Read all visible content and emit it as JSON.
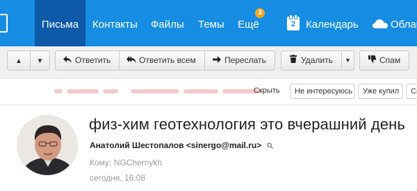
{
  "nav": {
    "items": [
      {
        "label": "Письма"
      },
      {
        "label": "Контакты"
      },
      {
        "label": "Файлы"
      },
      {
        "label": "Темы"
      },
      {
        "label": "Ещё"
      },
      {
        "label": "Календарь"
      },
      {
        "label": "Облако"
      }
    ],
    "more_badge": "3",
    "calendar_day": "2",
    "active": "Письма",
    "colors": {
      "bar": "#168de2",
      "active": "#0f5aa8",
      "badge": "#f5a623"
    }
  },
  "toolbar": {
    "up_icon": "arrow-up-icon",
    "down_icon": "arrow-down-icon",
    "reply": {
      "label": "Ответить",
      "icon": "reply-icon"
    },
    "reply_all": {
      "label": "Ответить всем",
      "icon": "reply-all-icon"
    },
    "forward": {
      "label": "Переслать",
      "icon": "forward-icon"
    },
    "delete": {
      "label": "Удалить",
      "icon": "trash-icon"
    },
    "spam": {
      "label": "Спам",
      "icon": "thumbs-down-icon"
    }
  },
  "filters": {
    "hide": "Скрыть",
    "chips": [
      "Не интересуюсь",
      "Уже купил",
      "Спам"
    ]
  },
  "message": {
    "subject": "физ-хим геотехнология это вчерашний день",
    "sender_name": "Анатолий Шестопалов",
    "sender_email": "<sinergo@mail.ru>",
    "to_label": "Кому:",
    "to_value": "NGChernykh",
    "date": "сегодня, 16:08"
  }
}
